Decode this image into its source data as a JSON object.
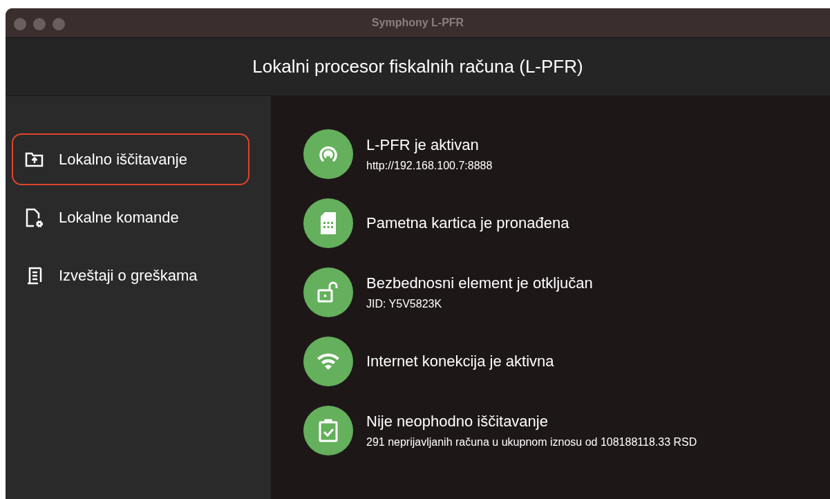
{
  "window": {
    "title": "Symphony L-PFR"
  },
  "header": {
    "title": "Lokalni procesor fiskalnih računa (L-PFR)"
  },
  "sidebar": {
    "items": [
      {
        "kind": "folder-upload",
        "label": "Lokalno iščitavanje",
        "selected": true
      },
      {
        "kind": "file-gear",
        "label": "Lokalne komande",
        "selected": false
      },
      {
        "kind": "report",
        "label": "Izveštaji o greškama",
        "selected": false
      }
    ]
  },
  "statuses": [
    {
      "kind": "broadcast",
      "title": "L-PFR je aktivan",
      "detail": "http://192.168.100.7:8888"
    },
    {
      "kind": "sim",
      "title": "Pametna kartica je pronađena"
    },
    {
      "kind": "unlock",
      "title": "Bezbednosni element je otključan",
      "detail": "JID: Y5V5823K"
    },
    {
      "kind": "wifi",
      "title": "Internet konekcija je aktivna"
    },
    {
      "kind": "clipboard",
      "title": "Nije neophodno iščitavanje",
      "detail": "291 neprijavljanih računa u ukupnom iznosu od 108188118.33 RSD"
    }
  ]
}
